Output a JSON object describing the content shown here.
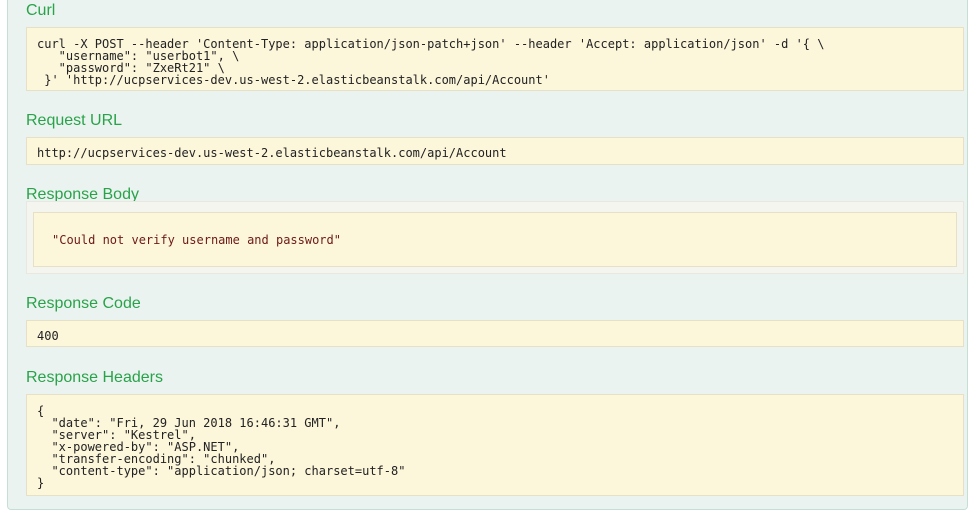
{
  "curl": {
    "heading": "Curl",
    "command": "curl -X POST --header 'Content-Type: application/json-patch+json' --header 'Accept: application/json' -d '{ \\\n   \"username\": \"userbot1\", \\\n   \"password\": \"ZxeRt21\" \\\n }' 'http://ucpservices-dev.us-west-2.elasticbeanstalk.com/api/Account'"
  },
  "request_url": {
    "heading": "Request URL",
    "value": "http://ucpservices-dev.us-west-2.elasticbeanstalk.com/api/Account"
  },
  "response_body": {
    "heading": "Response Body",
    "value": "\"Could not verify username and password\""
  },
  "response_code": {
    "heading": "Response Code",
    "value": "400"
  },
  "response_headers": {
    "heading": "Response Headers",
    "value": "{\n  \"date\": \"Fri, 29 Jun 2018 16:46:31 GMT\",\n  \"server\": \"Kestrel\",\n  \"x-powered-by\": \"ASP.NET\",\n  \"transfer-encoding\": \"chunked\",\n  \"content-type\": \"application/json; charset=utf-8\"\n}"
  },
  "colors": {
    "heading": "#29a34a",
    "code_background": "#fcf6db",
    "panel_background": "#ebf3f0",
    "response_text": "#6d1a16"
  }
}
